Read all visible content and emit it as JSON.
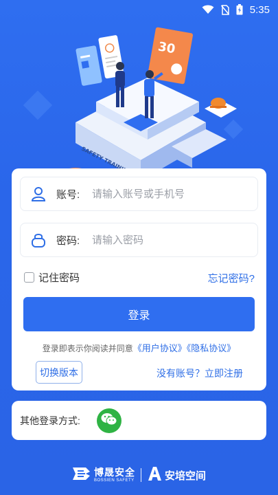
{
  "status_bar": {
    "time": "5:35",
    "icons": [
      "wifi-icon",
      "no-sim-icon",
      "battery-icon"
    ]
  },
  "hero": {
    "sign_text": "SAFETY TRAINING",
    "board_text": "30"
  },
  "login": {
    "account": {
      "label": "账号:",
      "placeholder": "请输入账号或手机号",
      "icon": "user-icon"
    },
    "password": {
      "label": "密码:",
      "placeholder": "请输入密码",
      "icon": "lock-icon"
    },
    "remember_label": "记住密码",
    "forgot_label": "忘记密码?",
    "submit_label": "登录",
    "agreement": {
      "prefix": "登录即表示你阅读并同意",
      "user_agreement": "《用户协议》",
      "privacy_agreement": "《隐私协议》"
    },
    "switch_version_label": "切换版本",
    "register_label": "没有账号？立即注册"
  },
  "other_login": {
    "label": "其他登录方式:",
    "wechat_icon": "wechat-icon"
  },
  "footer": {
    "brand1_cn": "博晟安全",
    "brand1_en": "BOSSIEN SAFETY",
    "brand2": "安培空间"
  },
  "colors": {
    "background": "#2f6ef0",
    "primary": "#2f6ef0",
    "link": "#2e6ee6",
    "wechat": "#2fb344"
  }
}
